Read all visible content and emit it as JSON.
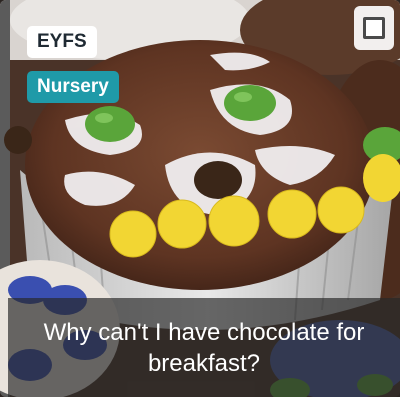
{
  "card": {
    "stage_label": "EYFS",
    "group_label": "Nursery",
    "caption": "Why can't I have chocolate for breakfast?",
    "group_color": "#1f9aa8",
    "image_subject": "chocolate cupcake decorated with icing and candy buttons"
  }
}
